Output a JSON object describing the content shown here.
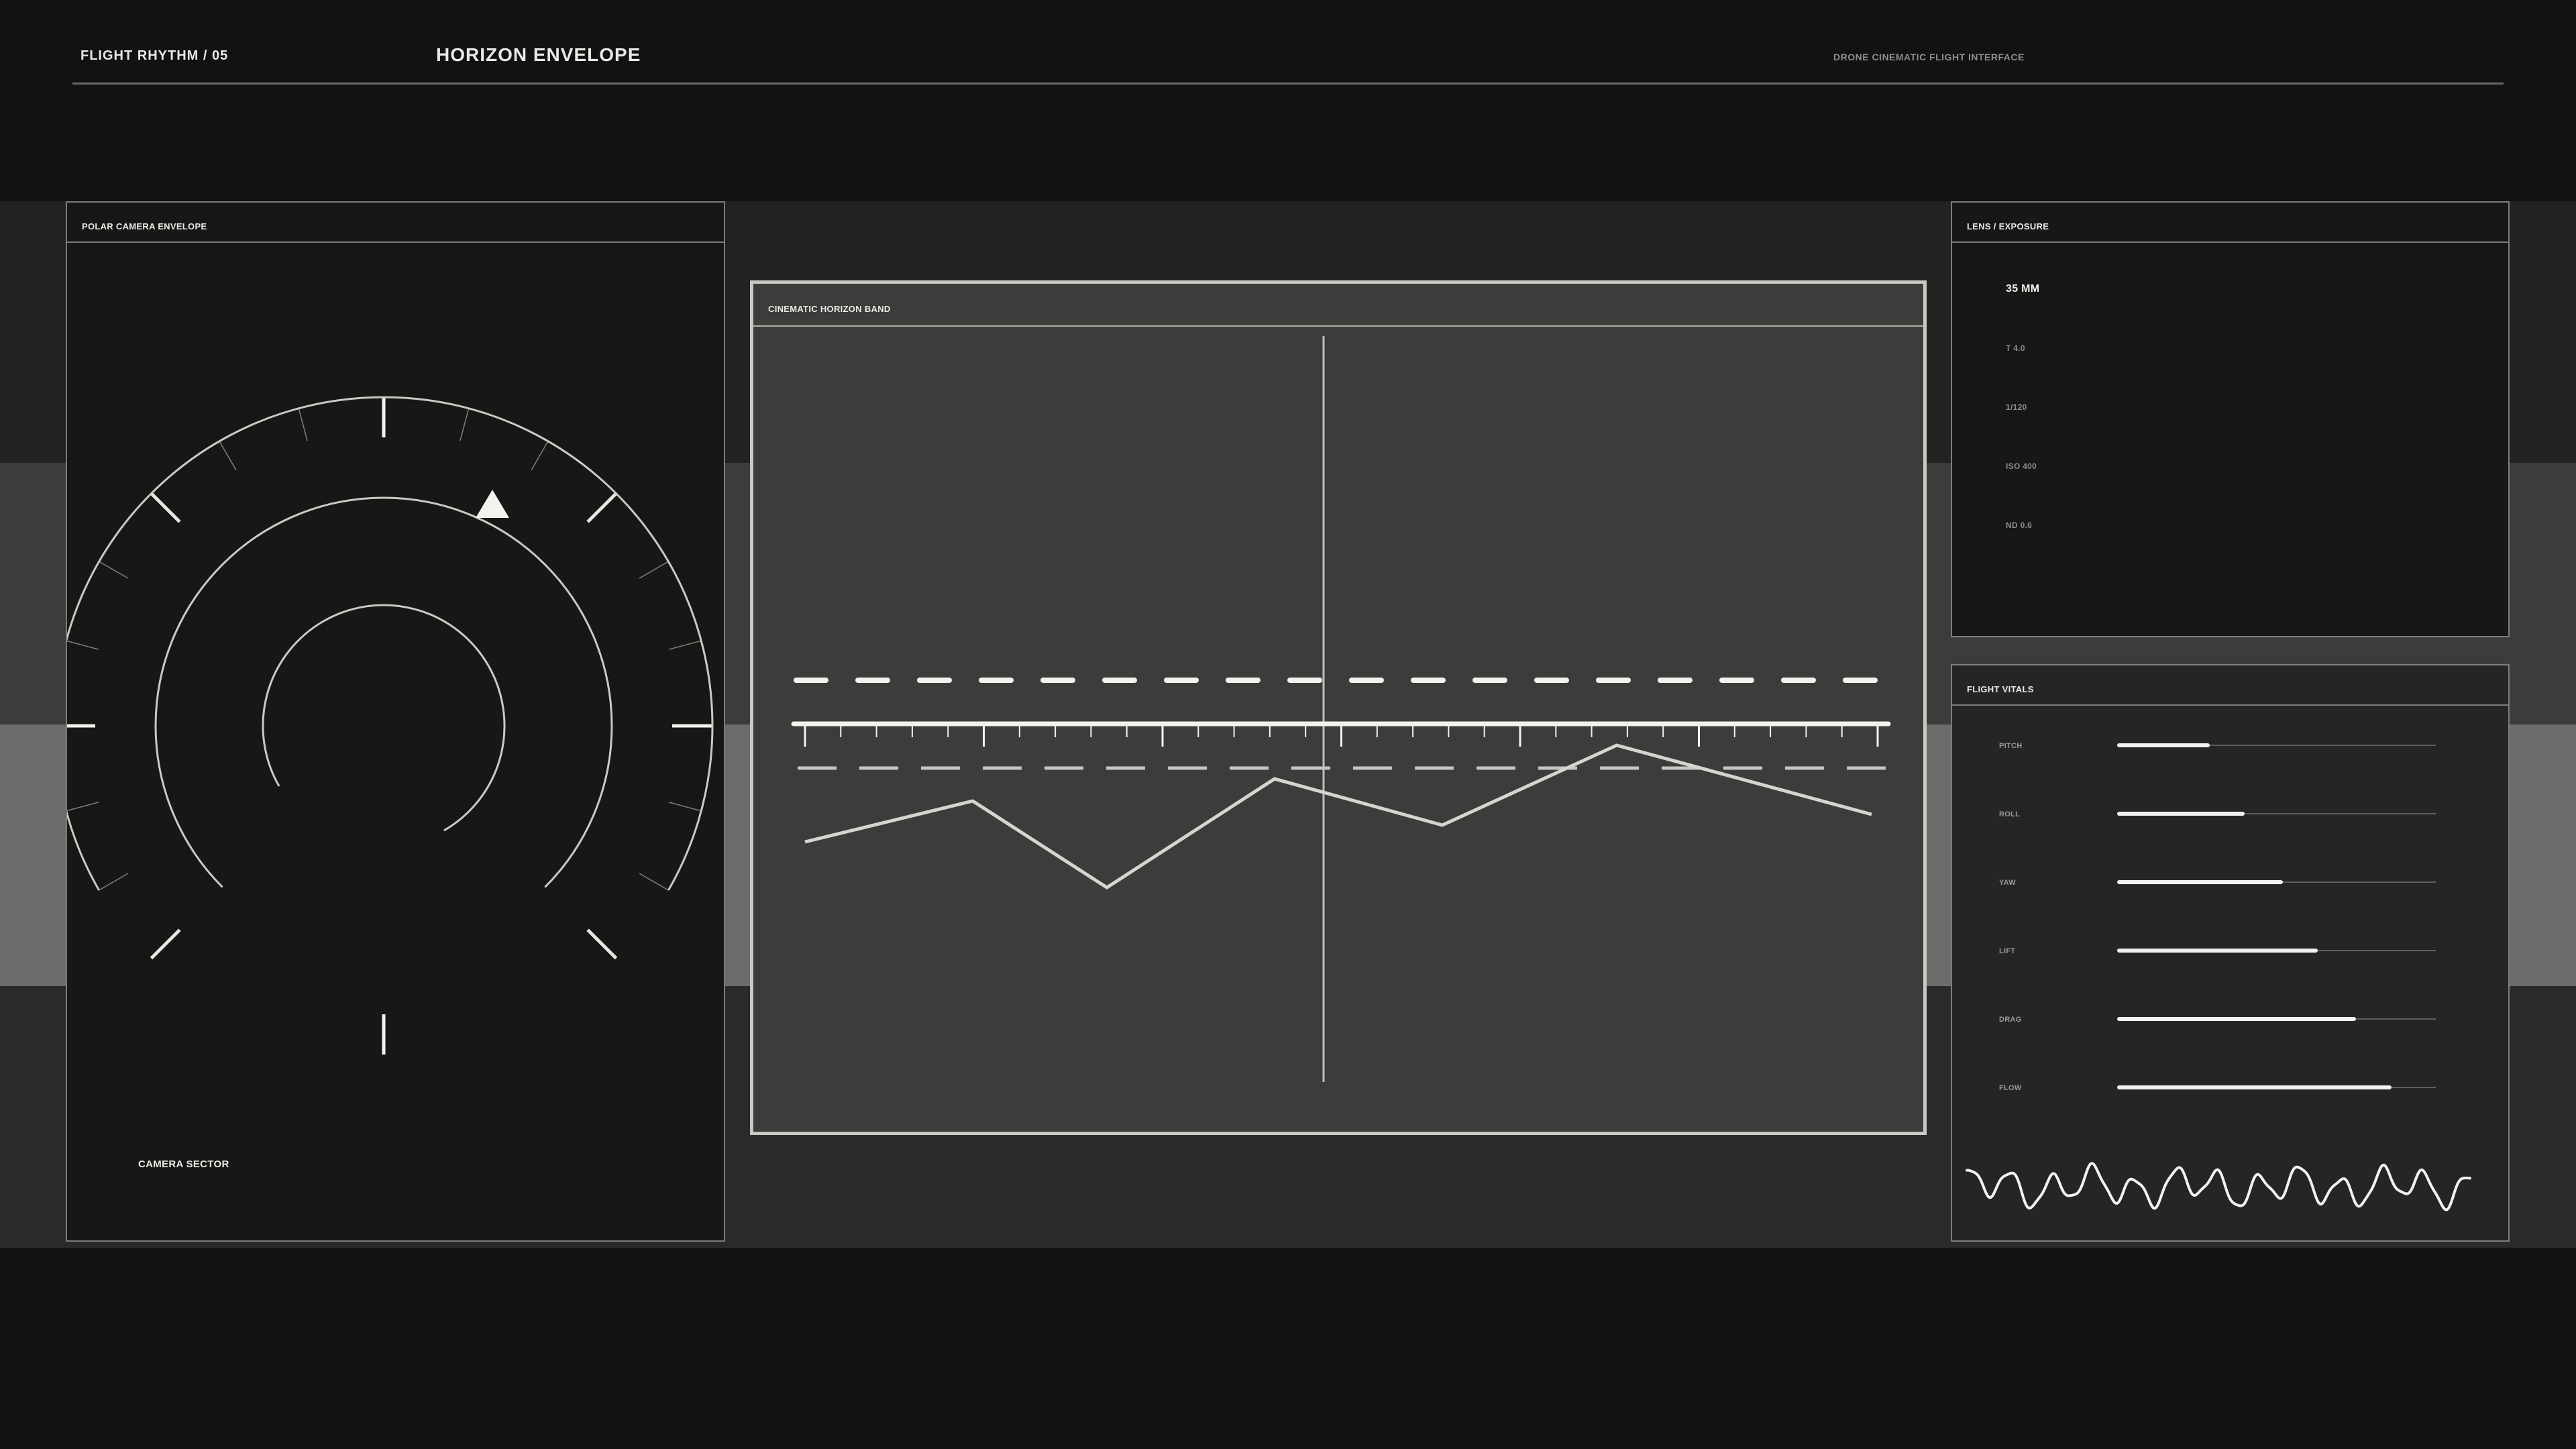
{
  "header": {
    "rhythm_label": "FLIGHT RHYTHM / 05",
    "title": "HORIZON ENVELOPE",
    "subtitle": "DRONE CINEMATIC FLIGHT INTERFACE"
  },
  "polar_panel": {
    "title": "POLAR CAMERA ENVELOPE",
    "sector_label": "CAMERA SECTOR",
    "heading_marker_icon": "triangle-icon"
  },
  "horizon_panel": {
    "title": "CINEMATIC HORIZON BAND"
  },
  "lens_panel": {
    "title": "LENS / EXPOSURE",
    "focal_length": "35 MM",
    "aperture": "T 4.0",
    "shutter": "1/120",
    "iso": "ISO 400",
    "nd": "ND 0.6"
  },
  "vitals_panel": {
    "title": "FLIGHT VITALS",
    "items": [
      {
        "label": "PITCH",
        "value": 0.29
      },
      {
        "label": "ROLL",
        "value": 0.4
      },
      {
        "label": "YAW",
        "value": 0.52
      },
      {
        "label": "LIFT",
        "value": 0.63
      },
      {
        "label": "DRAG",
        "value": 0.75
      },
      {
        "label": "FLOW",
        "value": 0.86
      }
    ]
  },
  "colors": {
    "background": "#111312",
    "accent": "#f2f3ef",
    "muted": "#8d8f8b"
  }
}
